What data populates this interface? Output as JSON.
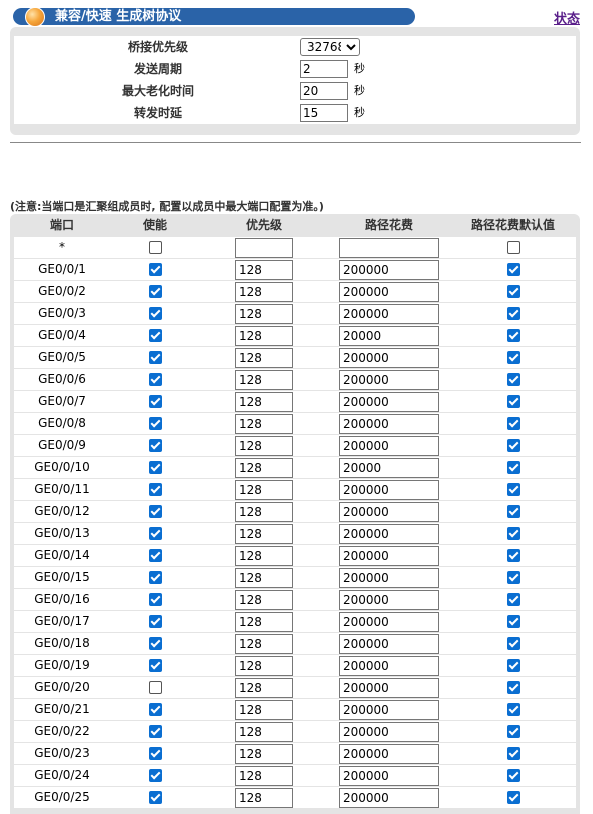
{
  "header": {
    "title": "兼容/快速 生成树协议",
    "status_link": "状态"
  },
  "bridge": {
    "priority_label": "桥接优先级",
    "priority_value": "32768",
    "hello_label": "发送周期",
    "hello_value": "2",
    "hello_unit": "秒",
    "max_age_label": "最大老化时间",
    "max_age_value": "20",
    "max_age_unit": "秒",
    "forward_delay_label": "转发时延",
    "forward_delay_value": "15",
    "forward_delay_unit": "秒"
  },
  "note": "(注意:当端口是汇聚组成员时, 配置以成员中最大端口配置为准。)",
  "ports": {
    "headers": {
      "port": "端口",
      "enable": "使能",
      "priority": "优先级",
      "cost": "路径花费",
      "cost_default": "路径花费默认值"
    },
    "all_row": {
      "port": "*",
      "enable": false,
      "priority": "",
      "cost": "",
      "cost_default": false
    },
    "rows": [
      {
        "port": "GE0/0/1",
        "enable": true,
        "priority": "128",
        "cost": "200000",
        "cost_default": true
      },
      {
        "port": "GE0/0/2",
        "enable": true,
        "priority": "128",
        "cost": "200000",
        "cost_default": true
      },
      {
        "port": "GE0/0/3",
        "enable": true,
        "priority": "128",
        "cost": "200000",
        "cost_default": true
      },
      {
        "port": "GE0/0/4",
        "enable": true,
        "priority": "128",
        "cost": "20000",
        "cost_default": true
      },
      {
        "port": "GE0/0/5",
        "enable": true,
        "priority": "128",
        "cost": "200000",
        "cost_default": true
      },
      {
        "port": "GE0/0/6",
        "enable": true,
        "priority": "128",
        "cost": "200000",
        "cost_default": true
      },
      {
        "port": "GE0/0/7",
        "enable": true,
        "priority": "128",
        "cost": "200000",
        "cost_default": true
      },
      {
        "port": "GE0/0/8",
        "enable": true,
        "priority": "128",
        "cost": "200000",
        "cost_default": true
      },
      {
        "port": "GE0/0/9",
        "enable": true,
        "priority": "128",
        "cost": "200000",
        "cost_default": true
      },
      {
        "port": "GE0/0/10",
        "enable": true,
        "priority": "128",
        "cost": "20000",
        "cost_default": true
      },
      {
        "port": "GE0/0/11",
        "enable": true,
        "priority": "128",
        "cost": "200000",
        "cost_default": true
      },
      {
        "port": "GE0/0/12",
        "enable": true,
        "priority": "128",
        "cost": "200000",
        "cost_default": true
      },
      {
        "port": "GE0/0/13",
        "enable": true,
        "priority": "128",
        "cost": "200000",
        "cost_default": true
      },
      {
        "port": "GE0/0/14",
        "enable": true,
        "priority": "128",
        "cost": "200000",
        "cost_default": true
      },
      {
        "port": "GE0/0/15",
        "enable": true,
        "priority": "128",
        "cost": "200000",
        "cost_default": true
      },
      {
        "port": "GE0/0/16",
        "enable": true,
        "priority": "128",
        "cost": "200000",
        "cost_default": true
      },
      {
        "port": "GE0/0/17",
        "enable": true,
        "priority": "128",
        "cost": "200000",
        "cost_default": true
      },
      {
        "port": "GE0/0/18",
        "enable": true,
        "priority": "128",
        "cost": "200000",
        "cost_default": true
      },
      {
        "port": "GE0/0/19",
        "enable": true,
        "priority": "128",
        "cost": "200000",
        "cost_default": true
      },
      {
        "port": "GE0/0/20",
        "enable": false,
        "priority": "128",
        "cost": "200000",
        "cost_default": true
      },
      {
        "port": "GE0/0/21",
        "enable": true,
        "priority": "128",
        "cost": "200000",
        "cost_default": true
      },
      {
        "port": "GE0/0/22",
        "enable": true,
        "priority": "128",
        "cost": "200000",
        "cost_default": true
      },
      {
        "port": "GE0/0/23",
        "enable": true,
        "priority": "128",
        "cost": "200000",
        "cost_default": true
      },
      {
        "port": "GE0/0/24",
        "enable": true,
        "priority": "128",
        "cost": "200000",
        "cost_default": true
      },
      {
        "port": "GE0/0/25",
        "enable": true,
        "priority": "128",
        "cost": "200000",
        "cost_default": true
      }
    ]
  }
}
